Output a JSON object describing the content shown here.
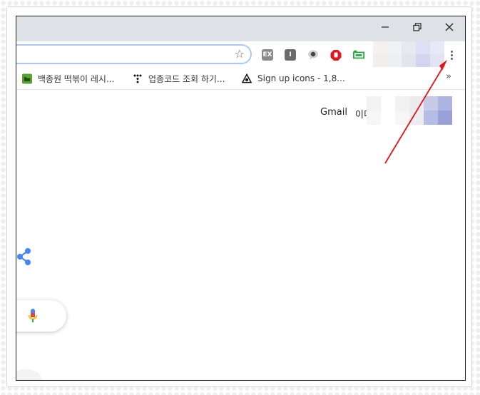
{
  "window": {
    "controls": {
      "minimize_icon": "minimize-icon",
      "restore_icon": "restore-icon",
      "close_icon": "close-icon"
    }
  },
  "toolbar": {
    "bookmark_star_icon": "star-icon",
    "extensions": [
      {
        "icon": "ex-extension-icon",
        "label": "EX",
        "color": "#8a8a8a"
      },
      {
        "icon": "info-extension-icon",
        "label": "I",
        "color": "#6b6b6b"
      },
      {
        "icon": "speech-extension-icon",
        "label": "",
        "color": "#555555"
      },
      {
        "icon": "stop-hand-extension-icon",
        "label": "",
        "color": "#e0191f"
      },
      {
        "icon": "tab-extension-icon",
        "label": "",
        "color": "#23a83d"
      }
    ],
    "menu_icon": "more-vert-icon"
  },
  "bookmarks": {
    "items": [
      {
        "icon": "folder-green-icon",
        "label": "백종원 떡볶이 레시..."
      },
      {
        "icon": "dots-logo-icon",
        "label": "업종코드 조회 하기..."
      },
      {
        "icon": "eye-logo-icon",
        "label": "Sign up icons - 1,8..."
      }
    ],
    "overflow_label": "»"
  },
  "page": {
    "gmail_link": "Gmail",
    "images_link_partial": "이미"
  },
  "colors": {
    "titlebar": "#dee1e6",
    "omnibox_focus": "#a8c7fa",
    "annotation_arrow": "#e01616",
    "share_blue": "#4285f4"
  }
}
